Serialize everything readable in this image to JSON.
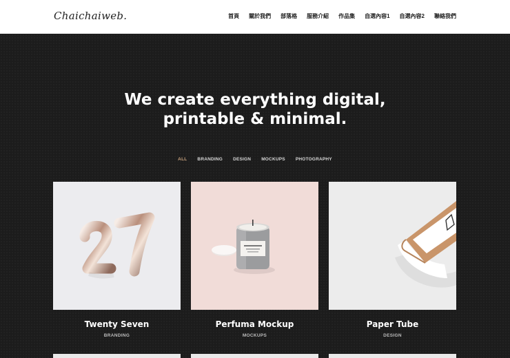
{
  "header": {
    "logo": "Chaichaiweb.",
    "nav": [
      "首頁",
      "關於我們",
      "部落格",
      "服務介紹",
      "作品集",
      "自選內容1",
      "自選內容2",
      "聯絡我們"
    ]
  },
  "hero": {
    "headline_line1": "We create everything digital,",
    "headline_line2": "printable & minimal."
  },
  "filters": {
    "items": [
      "ALL",
      "BRANDING",
      "DESIGN",
      "MOCKUPS",
      "PHOTOGRAPHY"
    ],
    "active": "ALL"
  },
  "portfolio": [
    {
      "title": "Twenty Seven",
      "category": "BRANDING",
      "image": "balloon-27"
    },
    {
      "title": "Perfuma Mockup",
      "category": "MOCKUPS",
      "image": "candle-jar"
    },
    {
      "title": "Paper Tube",
      "category": "DESIGN",
      "image": "paper-tube"
    }
  ],
  "colors": {
    "accent": "#c9a27e",
    "background": "#1c1c1c",
    "header": "#ffffff"
  }
}
